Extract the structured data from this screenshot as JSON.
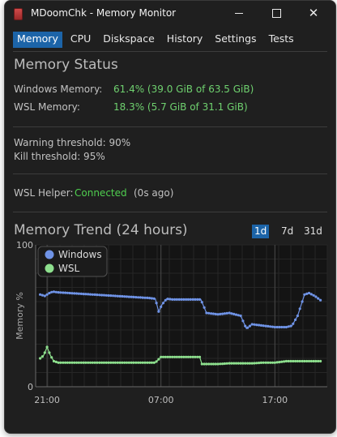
{
  "window": {
    "title": "MDoomChk - Memory Monitor"
  },
  "tabs": [
    {
      "label": "Memory",
      "active": true
    },
    {
      "label": "CPU",
      "active": false
    },
    {
      "label": "Diskspace",
      "active": false
    },
    {
      "label": "History",
      "active": false
    },
    {
      "label": "Settings",
      "active": false
    },
    {
      "label": "Tests",
      "active": false
    }
  ],
  "status": {
    "title": "Memory Status",
    "windows_label": "Windows Memory:",
    "windows_value": "61.4% (39.0 GiB of 63.5 GiB)",
    "wsl_label": "WSL Memory:",
    "wsl_value": "18.3% (5.7 GiB of 31.1 GiB)",
    "warning": "Warning threshold: 90%",
    "kill": "Kill threshold: 95%",
    "helper_label": "WSL Helper:",
    "helper_status": "Connected",
    "helper_age": "(0s ago)"
  },
  "trend": {
    "title": "Memory Trend (24 hours)",
    "ranges": [
      {
        "label": "1d",
        "active": true
      },
      {
        "label": "7d",
        "active": false
      },
      {
        "label": "31d",
        "active": false
      }
    ]
  },
  "colors": {
    "accent": "#1c64a8",
    "ok_green": "#6fd16f",
    "wsl_series": "#8ee08e",
    "windows_series": "#6f93e6"
  },
  "chart_data": {
    "type": "line",
    "title": "",
    "xlabel": "",
    "ylabel": "Memory %",
    "ylim": [
      0,
      100
    ],
    "yticks": [
      "0",
      "100"
    ],
    "xticks": [
      "21:00",
      "07:00",
      "17:00"
    ],
    "xtick_hours": [
      0,
      10,
      20
    ],
    "legend_placement": "top-left",
    "grid": true,
    "series": [
      {
        "name": "WSL",
        "color": "#8ee08e",
        "points": [
          [
            -0.6,
            20
          ],
          [
            -0.3,
            22
          ],
          [
            0,
            28
          ],
          [
            0.3,
            22
          ],
          [
            0.6,
            18
          ],
          [
            1,
            17
          ],
          [
            2,
            17
          ],
          [
            3,
            17
          ],
          [
            4,
            17
          ],
          [
            5,
            17
          ],
          [
            6,
            17
          ],
          [
            7,
            17
          ],
          [
            8,
            17
          ],
          [
            9,
            17
          ],
          [
            9.5,
            17
          ],
          [
            10,
            21
          ],
          [
            11,
            21
          ],
          [
            12,
            21
          ],
          [
            13,
            21
          ],
          [
            13.4,
            21
          ],
          [
            13.6,
            16
          ],
          [
            14,
            16
          ],
          [
            15,
            16
          ],
          [
            16,
            16.5
          ],
          [
            17,
            16.5
          ],
          [
            18,
            16.5
          ],
          [
            19,
            17
          ],
          [
            20,
            17
          ],
          [
            21,
            18
          ],
          [
            22,
            18
          ],
          [
            23,
            18
          ],
          [
            24,
            18
          ]
        ]
      },
      {
        "name": "Windows",
        "color": "#6f93e6",
        "points": [
          [
            -0.6,
            65
          ],
          [
            -0.2,
            64
          ],
          [
            0.2,
            66
          ],
          [
            0.5,
            67
          ],
          [
            1,
            66.5
          ],
          [
            2,
            66
          ],
          [
            3,
            65.5
          ],
          [
            4,
            65
          ],
          [
            5,
            64.5
          ],
          [
            6,
            64
          ],
          [
            7,
            63.5
          ],
          [
            8,
            63
          ],
          [
            9,
            62.5
          ],
          [
            9.5,
            62
          ],
          [
            9.8,
            53
          ],
          [
            10.1,
            58
          ],
          [
            10.5,
            62
          ],
          [
            11,
            61.5
          ],
          [
            12,
            61.5
          ],
          [
            13,
            61.5
          ],
          [
            13.5,
            61.5
          ],
          [
            14,
            52
          ],
          [
            15,
            51
          ],
          [
            16,
            52
          ],
          [
            17,
            50
          ],
          [
            17.5,
            41
          ],
          [
            18,
            44
          ],
          [
            19,
            43
          ],
          [
            20,
            42
          ],
          [
            21,
            42
          ],
          [
            21.5,
            43
          ],
          [
            22,
            50
          ],
          [
            22.6,
            65
          ],
          [
            23,
            66
          ],
          [
            23.5,
            64
          ],
          [
            24,
            61
          ]
        ]
      }
    ]
  }
}
